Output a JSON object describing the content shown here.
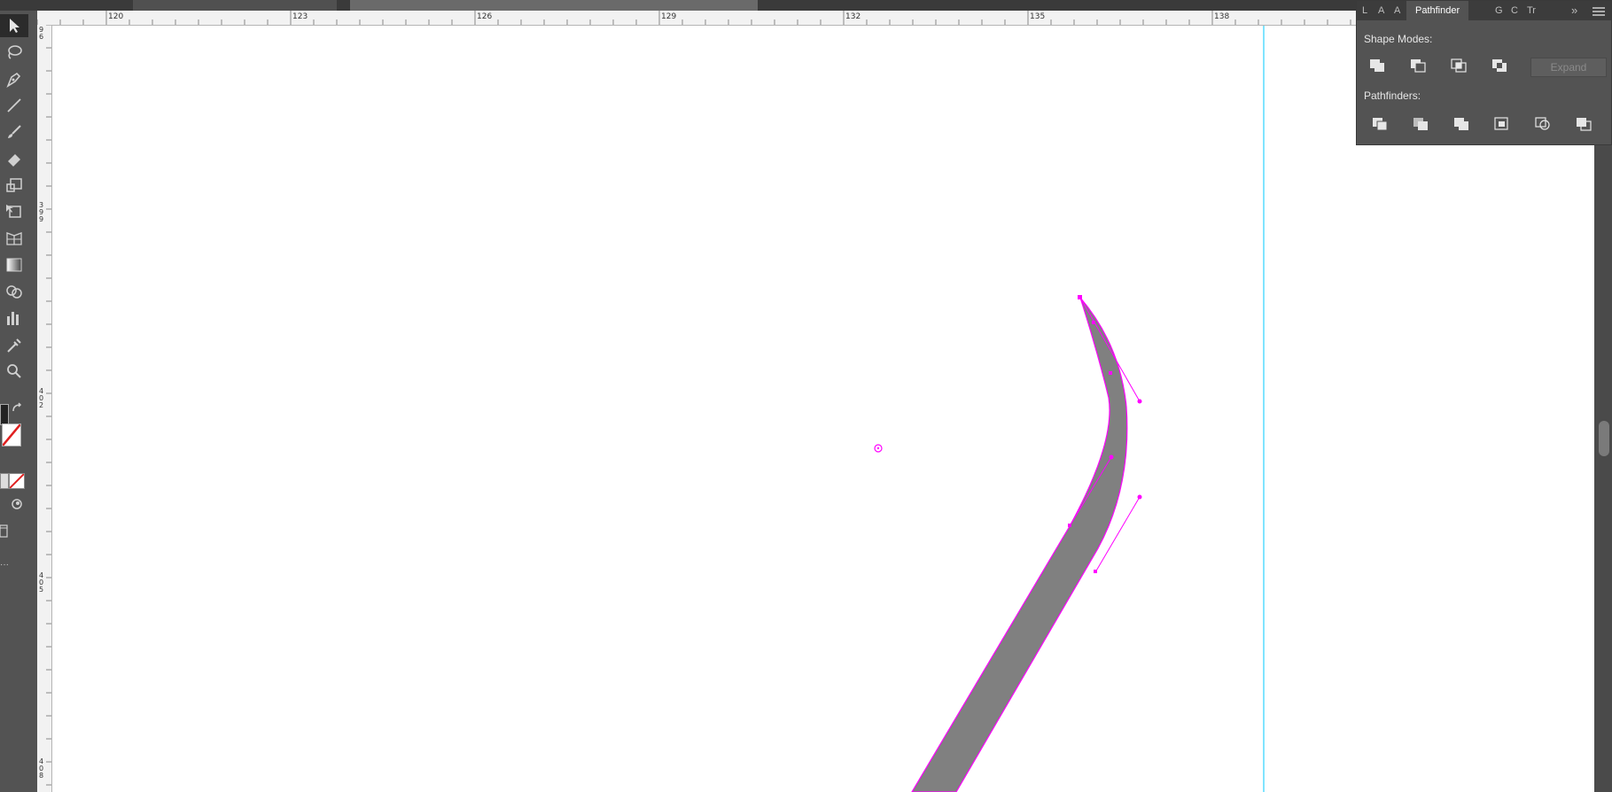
{
  "panel": {
    "tabs": [
      {
        "label": "L"
      },
      {
        "label": "A"
      },
      {
        "label": "A"
      },
      {
        "label": "Pathfinder"
      },
      {
        "label": "G"
      },
      {
        "label": "C"
      },
      {
        "label": "Tr"
      }
    ],
    "more_tabs_label": "»",
    "menu_icon": "hamburger-menu-icon",
    "shape_modes_label": "Shape Modes:",
    "pathfinders_label": "Pathfinders:",
    "expand_label": "Expand",
    "shape_mode_icons": [
      "unite-icon",
      "minus-front-icon",
      "intersect-icon",
      "exclude-icon"
    ],
    "pathfinder_icons": [
      "divide-icon",
      "trim-icon",
      "merge-icon",
      "crop-icon",
      "outline-icon",
      "minus-back-icon"
    ]
  },
  "ruler": {
    "top_labels": [
      "120",
      "123",
      "126",
      "129",
      "132",
      "135",
      "138"
    ],
    "left_labels": [
      "96",
      "399",
      "402",
      "405",
      "408"
    ]
  },
  "tools": [
    "selection-tool-icon",
    "lasso-tool-icon",
    "pen-tool-icon",
    "line-tool-icon",
    "paintbrush-tool-icon",
    "eraser-tool-icon",
    "scale-tool-icon",
    "free-transform-tool-icon",
    "perspective-grid-tool-icon",
    "gradient-tool-icon",
    "shape-builder-tool-icon",
    "column-graph-tool-icon",
    "eyedropper-tool-icon",
    "zoom-tool-icon"
  ],
  "colors": {
    "path_selection": "#ff00ff",
    "shape_fill": "#808080",
    "guide": "#00c8ff",
    "artboard": "#ffffff",
    "ui_background": "#535353"
  }
}
